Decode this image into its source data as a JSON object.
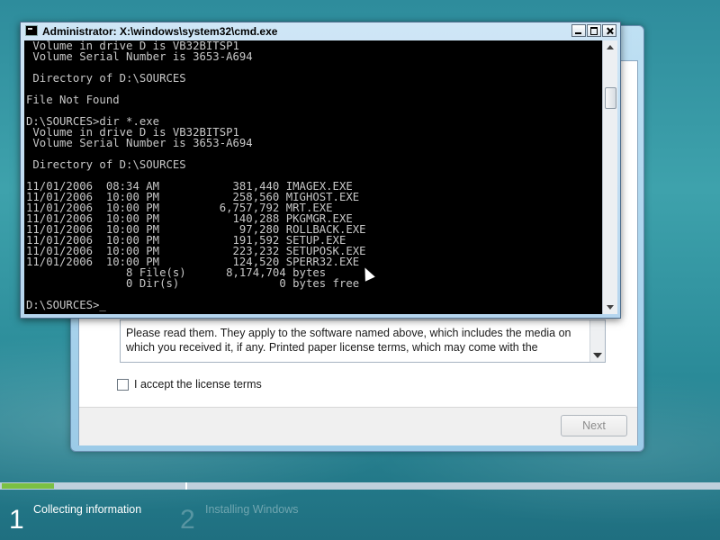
{
  "cmd": {
    "title": "Administrator: X:\\windows\\system32\\cmd.exe",
    "lines": [
      " Volume in drive D is VB32BITSP1",
      " Volume Serial Number is 3653-A694",
      "",
      " Directory of D:\\SOURCES",
      "",
      "File Not Found",
      "",
      "D:\\SOURCES>dir *.exe",
      " Volume in drive D is VB32BITSP1",
      " Volume Serial Number is 3653-A694",
      "",
      " Directory of D:\\SOURCES",
      "",
      "11/01/2006  08:34 AM           381,440 IMAGEX.EXE",
      "11/01/2006  10:00 PM           258,560 MIGHOST.EXE",
      "11/01/2006  10:00 PM         6,757,792 MRT.EXE",
      "11/01/2006  10:00 PM           140,288 PKGMGR.EXE",
      "11/01/2006  10:00 PM            97,280 ROLLBACK.EXE",
      "11/01/2006  10:00 PM           191,592 SETUP.EXE",
      "11/01/2006  10:00 PM           223,232 SETUPOSK.EXE",
      "11/01/2006  10:00 PM           124,520 SPERR32.EXE",
      "               8 File(s)      8,174,704 bytes",
      "               0 Dir(s)               0 bytes free",
      "",
      "D:\\SOURCES>_"
    ]
  },
  "setup": {
    "license_text": "Please read them.  They apply to the software named above, which includes the media on which you received it, if any.  Printed paper license terms, which may come with the",
    "accept_label": "I accept the license terms",
    "next_label": "Next"
  },
  "steps": [
    {
      "number": "1",
      "label": "Collecting information"
    },
    {
      "number": "2",
      "label": "Installing Windows"
    }
  ]
}
